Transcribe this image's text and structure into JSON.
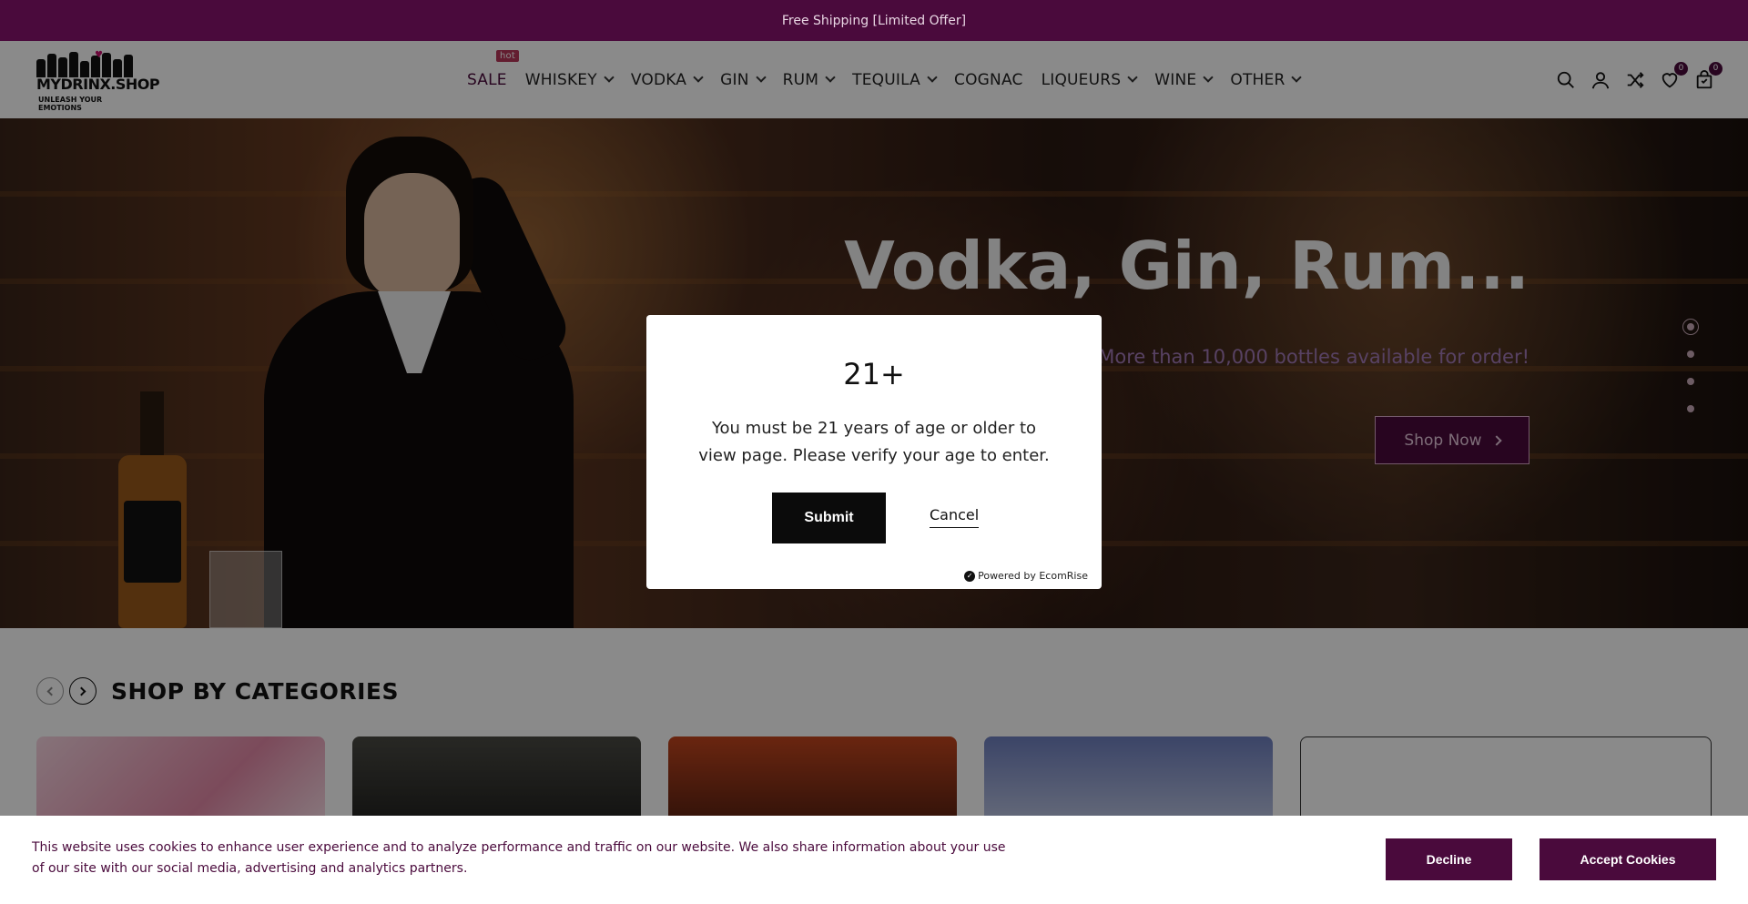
{
  "announcement": {
    "text": "Free Shipping [Limited Offer]"
  },
  "header": {
    "logo_text": "MYDRINX.SHOP",
    "logo_tagline": "UNLEASH YOUR EMOTIONS",
    "nav": [
      {
        "label": "SALE",
        "badge": "hot",
        "dropdown": false
      },
      {
        "label": "WHISKEY",
        "dropdown": true
      },
      {
        "label": "VODKA",
        "dropdown": true
      },
      {
        "label": "GIN",
        "dropdown": true
      },
      {
        "label": "RUM",
        "dropdown": true
      },
      {
        "label": "TEQUILA",
        "dropdown": true
      },
      {
        "label": "COGNAC",
        "dropdown": false
      },
      {
        "label": "LIQUEURS",
        "dropdown": true
      },
      {
        "label": "WINE",
        "dropdown": true
      },
      {
        "label": "OTHER",
        "dropdown": true
      }
    ],
    "icons": {
      "search": "search-icon",
      "account": "user-icon",
      "compare": "shuffle-icon",
      "wishlist": "heart-icon",
      "wishlist_count": "0",
      "cart": "bag-icon",
      "cart_count": "0"
    }
  },
  "hero": {
    "title": "Vodka, Gin, Rum...",
    "subtitle": "More than 10,000 bottles available for order!",
    "button_label": "Shop Now",
    "slides": 4,
    "active_slide": 1
  },
  "categories": {
    "title": "SHOP BY CATEGORIES"
  },
  "age_modal": {
    "title": "21+",
    "message": "You must be 21 years of age or older to view page. Please verify your age to enter.",
    "submit_label": "Submit",
    "cancel_label": "Cancel",
    "powered_by": "Powered by EcomRise"
  },
  "cookie_banner": {
    "text": "This website uses cookies to enhance user experience and to analyze performance and traffic on our website. We also share information about your use of our site with our social media, advertising and analytics partners.",
    "decline_label": "Decline",
    "accept_label": "Accept Cookies"
  },
  "colors": {
    "brand": "#4a0a3c",
    "badge": "#b8365a",
    "subtitle": "#a37ab8"
  }
}
